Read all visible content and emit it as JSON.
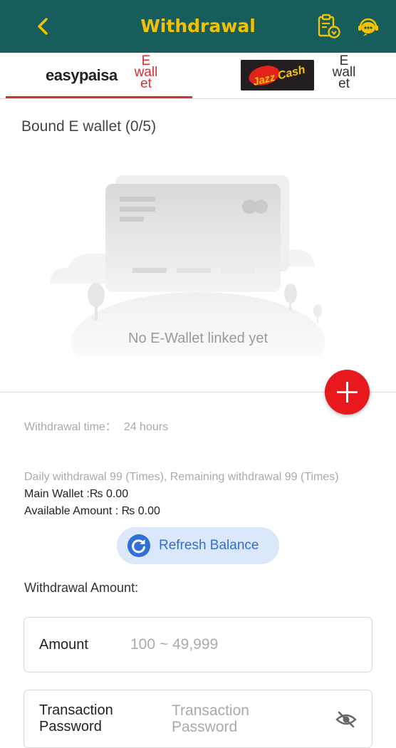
{
  "header": {
    "title": "Withdrawal"
  },
  "tabs": [
    {
      "logo": "easypaisa",
      "label": "E\nwall\net",
      "active": true
    },
    {
      "logo": "Jazz Cash",
      "label": "E\nwall\net",
      "active": false
    }
  ],
  "bound": {
    "title": "Bound E wallet (0/5)"
  },
  "empty_state": {
    "text": "No E-Wallet linked yet"
  },
  "withdrawal_time": {
    "label": "Withdrawal time：",
    "value": "24 hours"
  },
  "daily_limit": "Daily withdrawal 99 (Times), Remaining withdrawal 99 (Times)",
  "main_wallet": "Main Wallet :₨ 0.00",
  "available_amount": "Available Amount : ₨ 0.00",
  "refresh": {
    "label": "Refresh Balance"
  },
  "withdrawal_amount_label": "Withdrawal Amount:",
  "amount_field": {
    "label": "Amount",
    "placeholder": "100 ~ 49,999"
  },
  "password_field": {
    "label": "Transaction Password",
    "placeholder": "Transaction Password"
  },
  "colors": {
    "header": "#165d5c",
    "title": "#f2c200",
    "accent_red": "#e8191d",
    "tab_underline": "#d92e2e",
    "refresh": "#2f6fd6"
  },
  "icons": [
    "back-arrow-icon",
    "records-icon",
    "support-icon",
    "refresh-icon",
    "eye-off-icon",
    "add-icon"
  ]
}
